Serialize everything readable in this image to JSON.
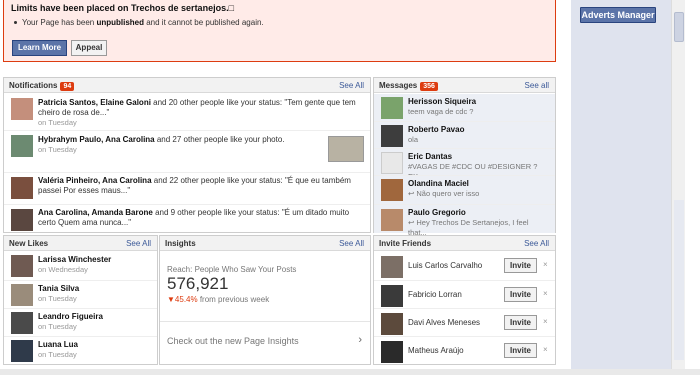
{
  "alert": {
    "title": "Limits have been placed on Trechos de sertanejos.□",
    "message_pre": "Your Page has been ",
    "message_bold": "unpublished",
    "message_post": " and it cannot be published again.",
    "learn_more": "Learn More",
    "appeal": "Appeal"
  },
  "sidebar": {
    "adverts_manager": "Adverts Manager"
  },
  "notifications": {
    "title": "Notifications",
    "count": "94",
    "see_all": "See All",
    "items": [
      {
        "names": "Patricia Santos, Elaine Galoni",
        "text": " and 20 other people like your status: \"Tem gente que tem cheiro de rosa de...\"",
        "time": "on Tuesday"
      },
      {
        "names": "Hybrahym Paulo, Ana Carolina",
        "text": " and 27 other people like your photo.",
        "time": "on Tuesday"
      },
      {
        "names": "Valéria Pinheiro, Ana Carolina",
        "text": " and 22 other people like your status: \"É que eu também passei Por esses maus...\"",
        "time": "on Tuesday"
      },
      {
        "names": "Ana Carolina, Amanda Barone",
        "text": " and 9 other people like your status: \"É um ditado muito certo Quem ama nunca...\"",
        "time": "on Tuesday"
      }
    ]
  },
  "messages": {
    "title": "Messages",
    "count": "356",
    "see_all": "See all",
    "items": [
      {
        "name": "Herisson Siqueira",
        "preview": "teem vaga de cdc ?"
      },
      {
        "name": "Roberto Pavao",
        "preview": "ola"
      },
      {
        "name": "Eric Dantas",
        "preview": "#VAGAS DE #CDC OU #DESIGNER ? EX-..."
      },
      {
        "name": "Olandina Maciel",
        "preview": "Não quero ver isso"
      },
      {
        "name": "Paulo Gregorio",
        "preview": "Hey Trechos De Sertanejos, I feel that..."
      }
    ]
  },
  "new_likes": {
    "title": "New Likes",
    "see_all": "See All",
    "items": [
      {
        "name": "Larissa Winchester",
        "time": "on Wednesday"
      },
      {
        "name": "Tania Silva",
        "time": "on Tuesday"
      },
      {
        "name": "Leandro Figueira",
        "time": "on Tuesday"
      },
      {
        "name": "Luana Lua",
        "time": "on Tuesday"
      }
    ]
  },
  "insights": {
    "title": "Insights",
    "see_all": "See All",
    "reach_label": "Reach: People Who Saw Your Posts",
    "reach_value": "576,921",
    "change_pct": "45.4%",
    "change_text": " from previous week",
    "link_text": "Check out the new Page Insights",
    "arrow": "›"
  },
  "invite_friends": {
    "title": "Invite Friends",
    "see_all": "See All",
    "button_label": "Invite",
    "close": "×",
    "items": [
      {
        "name": "Luis Carlos Carvalho"
      },
      {
        "name": "Fabricio Lorran"
      },
      {
        "name": "Davi Alves Meneses"
      },
      {
        "name": "Matheus Araújo"
      }
    ]
  },
  "colors": {
    "accent": "#3b5998",
    "alert_bg": "#ffebe8",
    "alert_border": "#dd3c10",
    "badge": "#dd3c10"
  }
}
